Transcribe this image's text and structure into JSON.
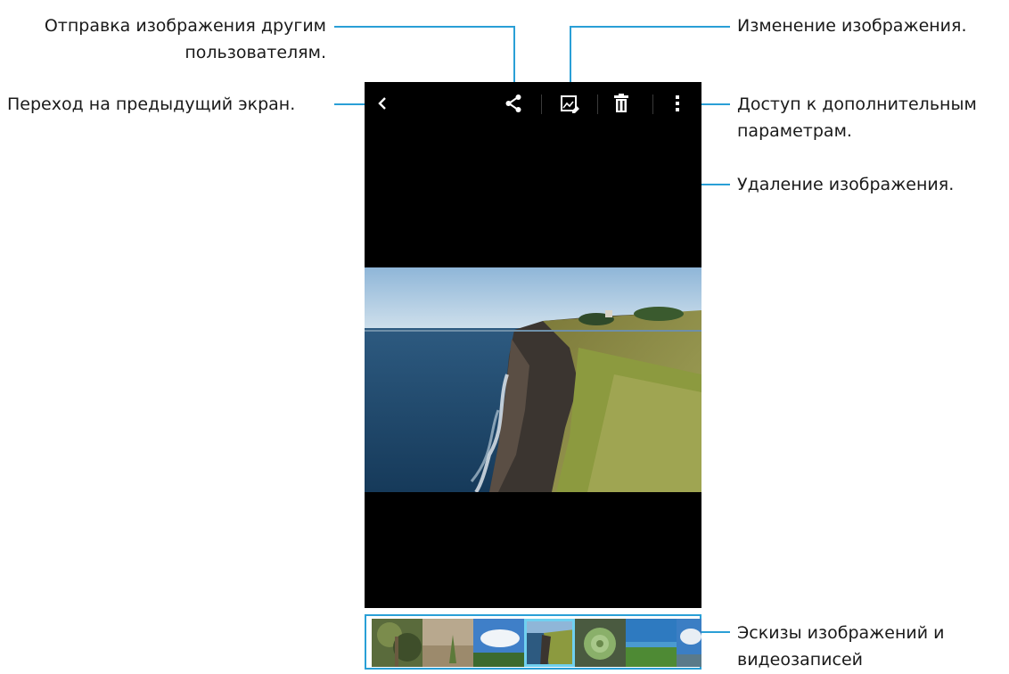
{
  "callouts": {
    "share": "Отправка изображения другим пользователям.",
    "edit": "Изменение изображения.",
    "back": "Переход на предыдущий экран.",
    "more": "Доступ к дополнительным параметрам.",
    "delete": "Удаление изображения.",
    "thumbnails": "Эскизы изображений и видеозаписей"
  },
  "actionbar": {
    "icons": [
      "back-icon",
      "share-icon",
      "edit-icon",
      "delete-icon",
      "more-icon"
    ]
  },
  "filmstrip": {
    "thumbnail_count": 7,
    "selected_index": 3
  },
  "colors": {
    "leader": "#2a9fd6",
    "selected_thumb": "#6fd0f0",
    "screen_bg": "#000000"
  }
}
